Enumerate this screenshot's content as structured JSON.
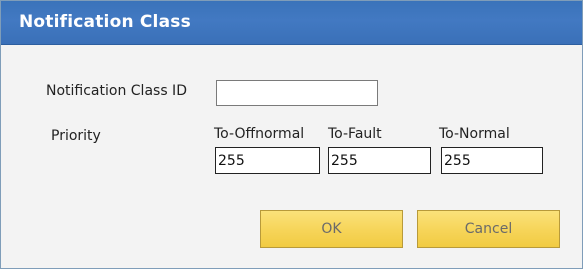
{
  "dialog": {
    "title": "Notification Class"
  },
  "form": {
    "notification_class_id": {
      "label": "Notification Class ID",
      "value": ""
    },
    "priority": {
      "label": "Priority",
      "to_offnormal": {
        "label": "To-Offnormal",
        "value": "255"
      },
      "to_fault": {
        "label": "To-Fault",
        "value": "255"
      },
      "to_normal": {
        "label": "To-Normal",
        "value": "255"
      }
    }
  },
  "buttons": {
    "ok_label": "OK",
    "cancel_label": "Cancel"
  },
  "colors": {
    "titlebar": "#3a73ba",
    "button_fill": "#f6d458",
    "background": "#f3f3f3"
  }
}
